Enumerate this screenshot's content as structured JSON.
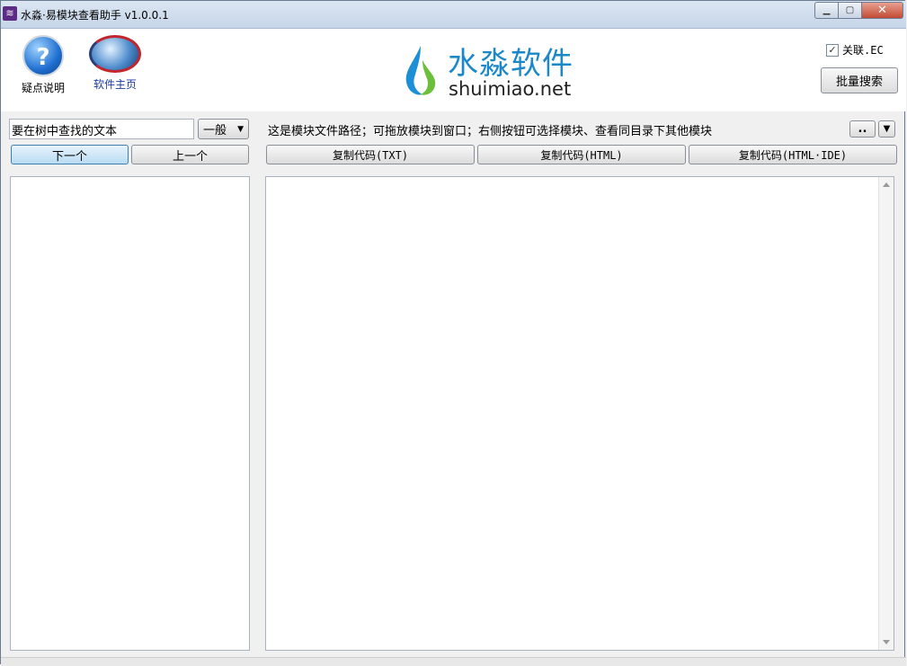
{
  "window": {
    "title": "水淼·易模块查看助手 v1.0.0.1",
    "app_icon": "app-icon"
  },
  "toolbar": {
    "help_label": "疑点说明",
    "home_label": "软件主页",
    "logo_cn": "水淼软件",
    "logo_en": "shuimiao.net",
    "link_ec_label": "关联.EC",
    "link_ec_checked": true,
    "batch_search_label": "批量搜索"
  },
  "left": {
    "search_value": "要在树中查找的文本",
    "mode_value": "一般",
    "next_label": "下一个",
    "prev_label": "上一个"
  },
  "right": {
    "path_value": "这是模块文件路径；可拖放模块到窗口；右侧按钮可选择模块、查看同目录下其他模块",
    "browse_label": "..",
    "copy_txt_label": "复制代码(TXT)",
    "copy_html_label": "复制代码(HTML)",
    "copy_html_ide_label": "复制代码(HTML·IDE)"
  },
  "colors": {
    "accent": "#1a88c9",
    "link": "#1b3aa8",
    "selected_button": "#b8dbf3"
  }
}
